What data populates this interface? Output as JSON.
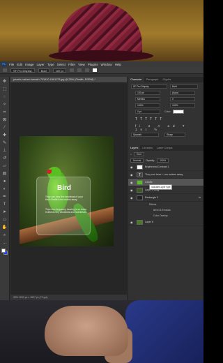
{
  "app": {
    "logo": "Ps",
    "menu": [
      "File",
      "Edit",
      "Image",
      "Layer",
      "Type",
      "Select",
      "Filter",
      "View",
      "Plugins",
      "Window",
      "Help"
    ]
  },
  "options_bar": {
    "font_family": "SF Pro Display",
    "font_style": "Bold",
    "font_size": "100 pt"
  },
  "document": {
    "tab_title": "pexels-roshan-kamath-701610-1661179.jpg @ 25% (Giraffe, RGB/8) *",
    "status": "25%   1200 px x 1627 px (72 ppi)"
  },
  "artwork": {
    "title": "Bird",
    "paragraph1": "They can hear the heartbeat of your their Giraffe from meters away.",
    "paragraph2": "Their low-frequency hearing is so sharp it detects tiny vibrations and heartbeats."
  },
  "character_panel": {
    "tabs": [
      "Character",
      "Paragraph",
      "Glyphs"
    ],
    "font_family": "SF Pro Display",
    "font_style": "Bold",
    "font_size": "100 pt",
    "leading": "(Auto)",
    "kerning": "Metrics",
    "tracking": "0",
    "vertical_scale": "100%",
    "horizontal_scale": "100%",
    "baseline_shift": "0 pt",
    "color_label": "Color:",
    "language": "Spanish",
    "antialias": "Sharp"
  },
  "layers_panel": {
    "tabs": [
      "Layers",
      "Libraries",
      "Layer Comps"
    ],
    "search_label": "Kind",
    "blend_mode": "Normal",
    "opacity_label": "Opacity:",
    "opacity": "100%",
    "layers": [
      {
        "name": "Brightness/Contrast 1",
        "type": "adjustment"
      },
      {
        "name": "They can hear t...om meters away",
        "type": "text"
      },
      {
        "name": "Giraffe",
        "type": "image"
      },
      {
        "name": "Layer 5 copy",
        "type": "image"
      },
      {
        "name": "Rectangle 3",
        "type": "shape"
      },
      {
        "name": "Layer 6",
        "type": "image"
      }
    ],
    "effects_label": "Effects",
    "effects": [
      "Bevel & Emboss",
      "Color Overlay"
    ],
    "tooltip": "Indicates layer type"
  },
  "colors": {
    "ps_background": "#323232",
    "accent": "#31a8ff",
    "bird_green": "#58c021",
    "beak_red": "#d61e2c"
  }
}
